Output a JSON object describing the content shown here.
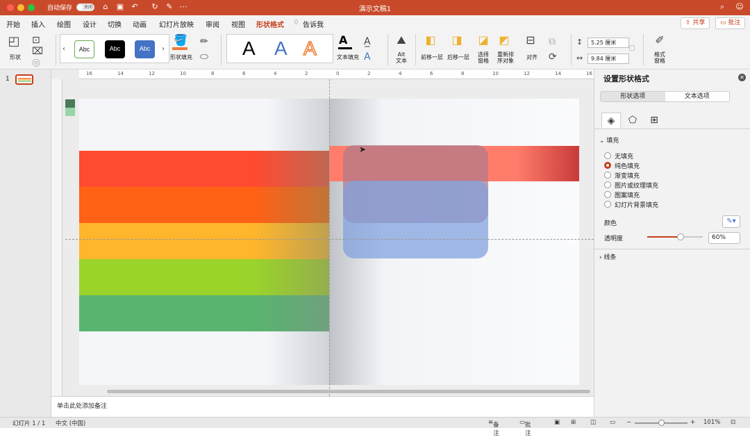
{
  "titlebar": {
    "autosave_label": "自动保存",
    "autosave_state": "关闭",
    "doc_title": "演示文稿1"
  },
  "menu": {
    "tabs": [
      "开始",
      "插入",
      "绘图",
      "设计",
      "切换",
      "动画",
      "幻灯片放映",
      "审阅",
      "视图",
      "形状格式",
      "告诉我"
    ],
    "active_tab": "形状格式",
    "share_label": "共享",
    "comments_label": "批注"
  },
  "ribbon": {
    "shape_label": "形状",
    "style_gallery": [
      "Abc",
      "Abc",
      "Abc"
    ],
    "shape_fill_label": "形状填充",
    "wordart_letters": [
      "A",
      "A",
      "A"
    ],
    "text_fill_label": "文本填充",
    "alt_text_label": "Alt\n文本",
    "bring_forward_label": "前移一层",
    "send_backward_label": "后移一层",
    "selection_pane_label": "选择\n窗格",
    "reorder_label": "重新排\n序对象",
    "align_label": "对齐",
    "height_value": "5.25 厘米",
    "width_value": "9.84 厘米",
    "format_pane_label": "格式\n窗格",
    "fill_color": "#f47a3a"
  },
  "ruler": {
    "labels": [
      "16",
      "14",
      "12",
      "10",
      "8",
      "6",
      "4",
      "2",
      "0",
      "2",
      "4",
      "6",
      "8",
      "10",
      "12",
      "14",
      "16"
    ]
  },
  "thumbnails": {
    "slide_number": "1"
  },
  "slide": {
    "band_colors": [
      "#ff8a6e",
      "#ff9d4a",
      "#ffd76a",
      "#c6e868",
      "#96d6a8"
    ],
    "right_band_color": "#ff7d6a",
    "overlay_colors": [
      "#b07a8c",
      "#7ea0dc"
    ]
  },
  "notes": {
    "placeholder": "单击此处添加备注"
  },
  "format_pane": {
    "title": "设置形状格式",
    "segments": [
      "形状选项",
      "文本选项"
    ],
    "fill_section": "填充",
    "fill_options": [
      "无填充",
      "纯色填充",
      "渐变填充",
      "图片或纹理填充",
      "图案填充",
      "幻灯片背景填充"
    ],
    "selected_fill": "纯色填充",
    "color_label": "颜色",
    "transparency_label": "透明度",
    "transparency_value": "60%",
    "transparency": 0.6,
    "line_section": "线条"
  },
  "status": {
    "slide_info": "幻灯片 1 / 1",
    "language": "中文 (中国)",
    "notes_label": "备注",
    "comments_label": "批注",
    "zoom": "101%"
  }
}
